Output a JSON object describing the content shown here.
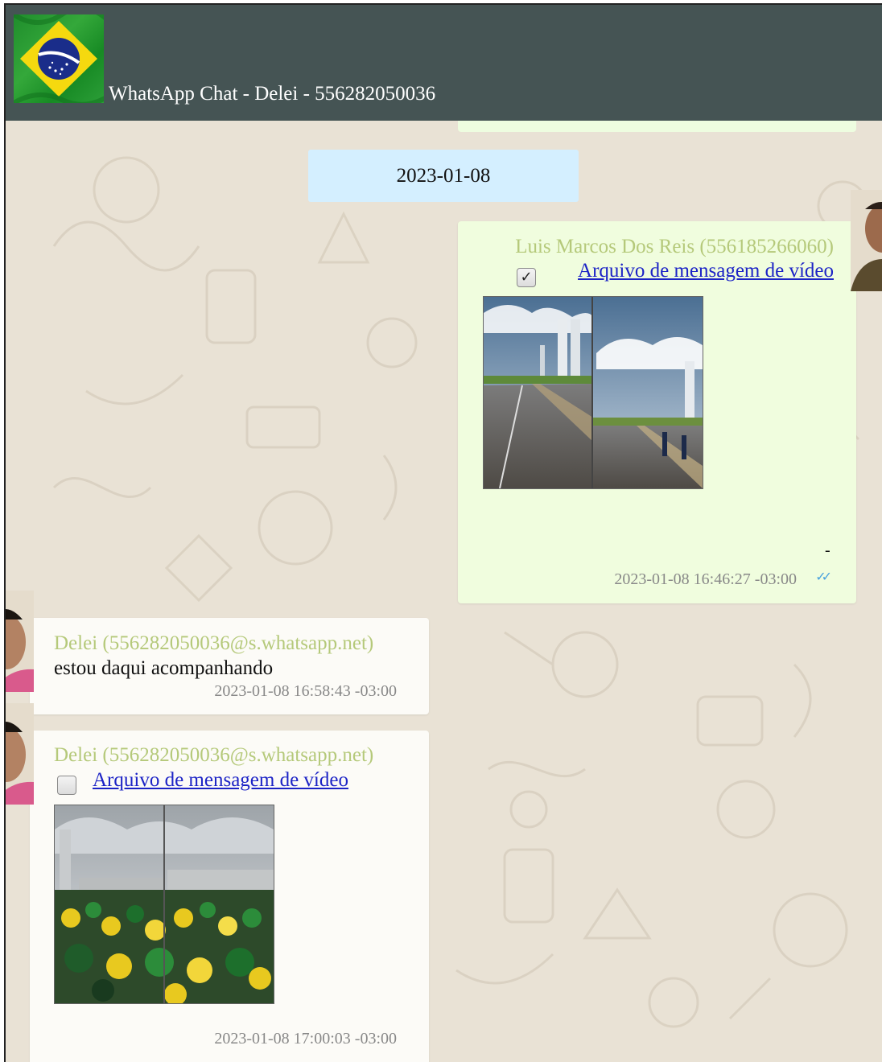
{
  "header": {
    "title": "WhatsApp Chat - Delei - 556282050036",
    "flag_icon": "brazil-flag-icon",
    "bar_color": "#455454"
  },
  "date_separator": "2023-01-08",
  "messages": [
    {
      "direction": "outgoing",
      "sender": "Luis Marcos Dos Reis (556185266060)",
      "checkbox_checked": true,
      "link_text": "Arquivo de mensagem de vídeo",
      "caption": "-",
      "timestamp": "2023-01-08 16:46:27 -03:00",
      "status_icon": "double-check-icon"
    },
    {
      "direction": "incoming",
      "sender": "Delei (556282050036@s.whatsapp.net)",
      "text": "estou daqui acompanhando",
      "timestamp": "2023-01-08 16:58:43 -03:00"
    },
    {
      "direction": "incoming",
      "sender": "Delei (556282050036@s.whatsapp.net)",
      "checkbox_checked": false,
      "link_text": "Arquivo de mensagem de vídeo",
      "timestamp": "2023-01-08 17:00:03 -03:00"
    }
  ],
  "colors": {
    "outgoing_bubble": "#f0fdde",
    "incoming_bubble": "#fcfbf7",
    "date_chip": "#d4efff",
    "sender_name": "#b5c97a",
    "link": "#1c23c6",
    "read_ticks": "#4aa3df"
  }
}
